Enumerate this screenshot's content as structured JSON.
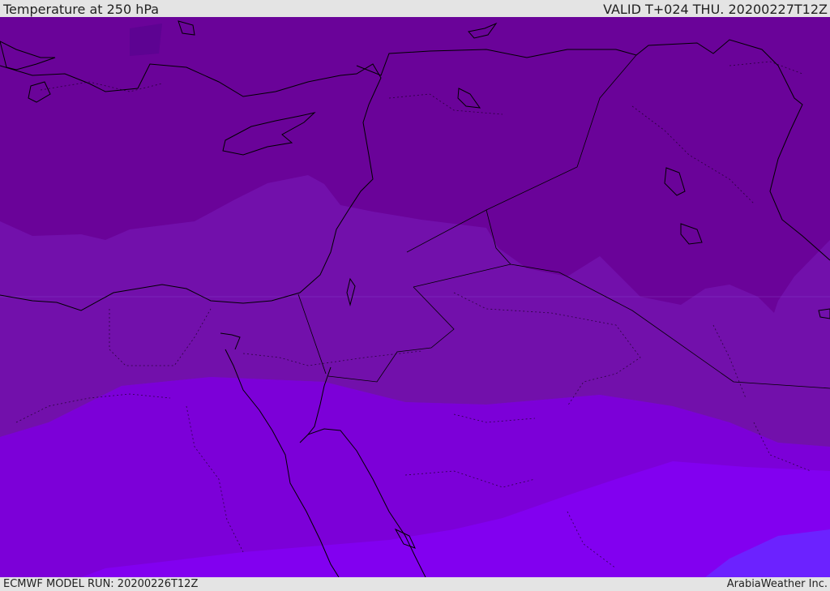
{
  "header": {
    "title": "Temperature at 250 hPa",
    "valid_time": "VALID T+024 THU. 20200227T12Z"
  },
  "footer": {
    "model_run": "ECMWF MODEL RUN: 20200226T12Z",
    "credit": "ArabiaWeather Inc."
  },
  "map": {
    "parameter": "Temperature",
    "level": "250 hPa",
    "fill_colors": [
      "#5d0392",
      "#6a0399",
      "#7210ab",
      "#7c00d8",
      "#8200f0",
      "#6c22ff"
    ],
    "coastline_color": "#000000"
  }
}
